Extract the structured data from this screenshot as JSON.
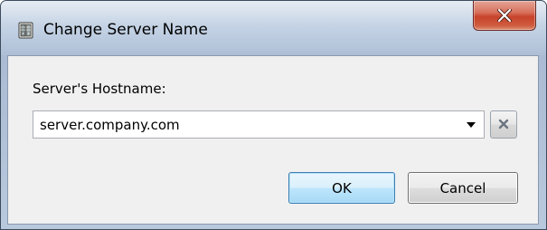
{
  "window": {
    "title": "Change Server Name",
    "icon": "server-icon",
    "close_icon": "close-x-icon"
  },
  "form": {
    "hostname_label": "Server's Hostname:",
    "hostname_value": "server.company.com",
    "dropdown_icon": "chevron-down-icon",
    "clear_icon": "clear-x-icon"
  },
  "buttons": {
    "ok_label": "OK",
    "cancel_label": "Cancel"
  },
  "colors": {
    "close_button": "#c7432a",
    "ok_border": "#3c7fb1",
    "client_background": "#f0f0f0"
  }
}
